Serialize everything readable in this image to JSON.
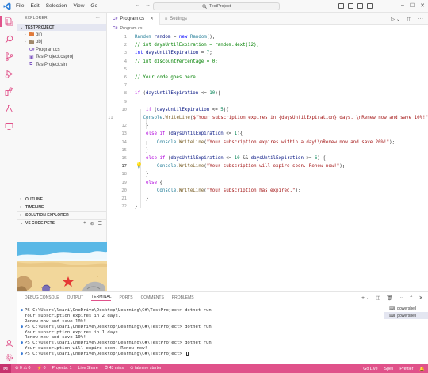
{
  "titlebar": {
    "menu": [
      "File",
      "Edit",
      "Selection",
      "View",
      "Go",
      "···"
    ],
    "search_text": "TestProject",
    "controls": {
      "minimize": "–",
      "maximize": "☐",
      "close": "✕"
    }
  },
  "colors": {
    "accent": "#e0528a",
    "accent_dark": "#c6336e",
    "selection": "#e4e6f1"
  },
  "sidebar": {
    "header": "EXPLORER",
    "header_more": "···",
    "project": "TESTPROJECT",
    "items": [
      {
        "label": "bin",
        "type": "folder"
      },
      {
        "label": "obj",
        "type": "folder"
      },
      {
        "label": "Program.cs",
        "type": "csharp"
      },
      {
        "label": "TestProject.csproj",
        "type": "csproj"
      },
      {
        "label": "TestProject.sln",
        "type": "sln"
      }
    ],
    "sections": {
      "outline": "OUTLINE",
      "timeline": "TIMELINE",
      "solution_explorer": "SOLUTION EXPLORER",
      "pets": "VS CODE PETS"
    },
    "pets_actions": [
      "+",
      "⊘",
      "☰"
    ]
  },
  "tabs": [
    {
      "label": "Program.cs",
      "active": true,
      "close": "✕"
    },
    {
      "label": "Settings",
      "active": false
    }
  ],
  "breadcrumb": {
    "icon": "C#",
    "file": "Program.cs"
  },
  "editor": {
    "current_line": "17",
    "lines": [
      {
        "n": "1",
        "tokens": [
          [
            "Random",
            "type"
          ],
          [
            " ",
            "op"
          ],
          [
            "random",
            "var"
          ],
          [
            " = ",
            "op"
          ],
          [
            "new",
            "kw"
          ],
          [
            " ",
            "op"
          ],
          [
            "Random",
            "type"
          ],
          [
            "();",
            "op"
          ]
        ]
      },
      {
        "n": "2",
        "tokens": [
          [
            "// int daysUntilExpiration = random.Next(12);",
            "com"
          ]
        ]
      },
      {
        "n": "3",
        "tokens": [
          [
            "int",
            "kw"
          ],
          [
            " ",
            "op"
          ],
          [
            "daysUntilExpiration",
            "var"
          ],
          [
            " = ",
            "op"
          ],
          [
            "7",
            "num"
          ],
          [
            ";",
            "op"
          ]
        ]
      },
      {
        "n": "4",
        "tokens": [
          [
            "// int discountPercentage = 0;",
            "com"
          ]
        ]
      },
      {
        "n": "5",
        "tokens": []
      },
      {
        "n": "6",
        "tokens": [
          [
            "// Your code goes here",
            "com"
          ]
        ]
      },
      {
        "n": "7",
        "tokens": []
      },
      {
        "n": "8",
        "tokens": [
          [
            "if",
            "ctl"
          ],
          [
            " (",
            "op"
          ],
          [
            "daysUntilExpiration",
            "var"
          ],
          [
            " <= ",
            "op"
          ],
          [
            "10",
            "num"
          ],
          [
            "){",
            "op"
          ]
        ]
      },
      {
        "n": "9",
        "tokens": []
      },
      {
        "n": "10",
        "tokens": [
          [
            "    ",
            "op"
          ],
          [
            "if",
            "ctl"
          ],
          [
            " (",
            "op"
          ],
          [
            "daysUntilExpiration",
            "var"
          ],
          [
            " <= ",
            "op"
          ],
          [
            "5",
            "num"
          ],
          [
            "){",
            "op"
          ]
        ]
      },
      {
        "n": "11",
        "tokens": [
          [
            "        ",
            "op"
          ],
          [
            "Console",
            "type"
          ],
          [
            ".",
            "op"
          ],
          [
            "WriteLine",
            "fn"
          ],
          [
            "(",
            "op"
          ],
          [
            "$\"Your subscription expires in {daysUntilExpiration} days. \\nRenew now and save 10%!\"",
            "str"
          ],
          [
            ");",
            "op"
          ]
        ]
      },
      {
        "n": "12",
        "tokens": [
          [
            "    }",
            "op"
          ]
        ]
      },
      {
        "n": "13",
        "tokens": [
          [
            "    ",
            "op"
          ],
          [
            "else",
            "ctl"
          ],
          [
            " ",
            "op"
          ],
          [
            "if",
            "ctl"
          ],
          [
            " (",
            "op"
          ],
          [
            "daysUntilExpiration",
            "var"
          ],
          [
            " <= ",
            "op"
          ],
          [
            "1",
            "num"
          ],
          [
            "){",
            "op"
          ]
        ]
      },
      {
        "n": "14",
        "tokens": [
          [
            "        ",
            "op"
          ],
          [
            "Console",
            "type"
          ],
          [
            ".",
            "op"
          ],
          [
            "WriteLine",
            "fn"
          ],
          [
            "(",
            "op"
          ],
          [
            "\"Your subscription expires within a day!\\nRenew now and save 20%!\"",
            "str"
          ],
          [
            ");",
            "op"
          ]
        ]
      },
      {
        "n": "15",
        "tokens": [
          [
            "    }",
            "op"
          ]
        ]
      },
      {
        "n": "16",
        "tokens": [
          [
            "    ",
            "op"
          ],
          [
            "else",
            "ctl"
          ],
          [
            " ",
            "op"
          ],
          [
            "if",
            "ctl"
          ],
          [
            " (",
            "op"
          ],
          [
            "daysUntilExpiration",
            "var"
          ],
          [
            " <= ",
            "op"
          ],
          [
            "10",
            "num"
          ],
          [
            " && ",
            "op"
          ],
          [
            "daysUntilExpiration",
            "var"
          ],
          [
            " >= ",
            "op"
          ],
          [
            "6",
            "num"
          ],
          [
            ") {",
            "op"
          ]
        ]
      },
      {
        "n": "17",
        "tokens": [
          [
            "        ",
            "op"
          ],
          [
            "Console",
            "type"
          ],
          [
            ".",
            "op"
          ],
          [
            "WriteLine",
            "fn"
          ],
          [
            "(",
            "op"
          ],
          [
            "\"Your subscription will expire soon. Renew now!\"",
            "str"
          ],
          [
            ");",
            "op"
          ]
        ]
      },
      {
        "n": "18",
        "tokens": [
          [
            "    }",
            "op"
          ]
        ]
      },
      {
        "n": "19",
        "tokens": [
          [
            "    ",
            "op"
          ],
          [
            "else",
            "ctl"
          ],
          [
            " {",
            "op"
          ]
        ]
      },
      {
        "n": "20",
        "tokens": [
          [
            "        ",
            "op"
          ],
          [
            "Console",
            "type"
          ],
          [
            ".",
            "op"
          ],
          [
            "WriteLine",
            "fn"
          ],
          [
            "(",
            "op"
          ],
          [
            "\"Your subscription has expired.\"",
            "str"
          ],
          [
            ");",
            "op"
          ]
        ]
      },
      {
        "n": "21",
        "tokens": [
          [
            "    }",
            "op"
          ]
        ]
      },
      {
        "n": "22",
        "tokens": [
          [
            "}",
            "op"
          ]
        ]
      }
    ]
  },
  "panel": {
    "tabs": [
      "DEBUG CONSOLE",
      "OUTPUT",
      "TERMINAL",
      "PORTS",
      "COMMENTS",
      "PROBLEMS"
    ],
    "active_tab": "TERMINAL",
    "terminal_lines": [
      {
        "dot": true,
        "text": "PS C:\\Users\\loari\\OneDrive\\Desktop\\Learning\\C#\\TestProject> dotnet run"
      },
      {
        "dot": false,
        "text": "Your subscription expires in 2 days."
      },
      {
        "dot": false,
        "text": "Renew now and save 10%!"
      },
      {
        "dot": true,
        "text": "PS C:\\Users\\loari\\OneDrive\\Desktop\\Learning\\C#\\TestProject> dotnet run"
      },
      {
        "dot": false,
        "text": "Your subscription expires in 1 days."
      },
      {
        "dot": false,
        "text": "Renew now and save 10%!"
      },
      {
        "dot": true,
        "text": "PS C:\\Users\\loari\\OneDrive\\Desktop\\Learning\\C#\\TestProject> dotnet run"
      },
      {
        "dot": false,
        "text": "Your subscription will expire soon. Renew now!"
      },
      {
        "dot": true,
        "text": "PS C:\\Users\\loari\\OneDrive\\Desktop\\Learning\\C#\\TestProject> "
      }
    ],
    "terminals": [
      "powershell",
      "powershell"
    ]
  },
  "status": {
    "left": [
      "⊗ 0 ⚠ 0",
      "⚡ 0",
      "Projects: 1",
      "Live Share",
      "⏱ 43 mins",
      "⊙ tabnine starter"
    ],
    "right": [
      "Go Live",
      "Spell",
      "Prettier"
    ]
  }
}
